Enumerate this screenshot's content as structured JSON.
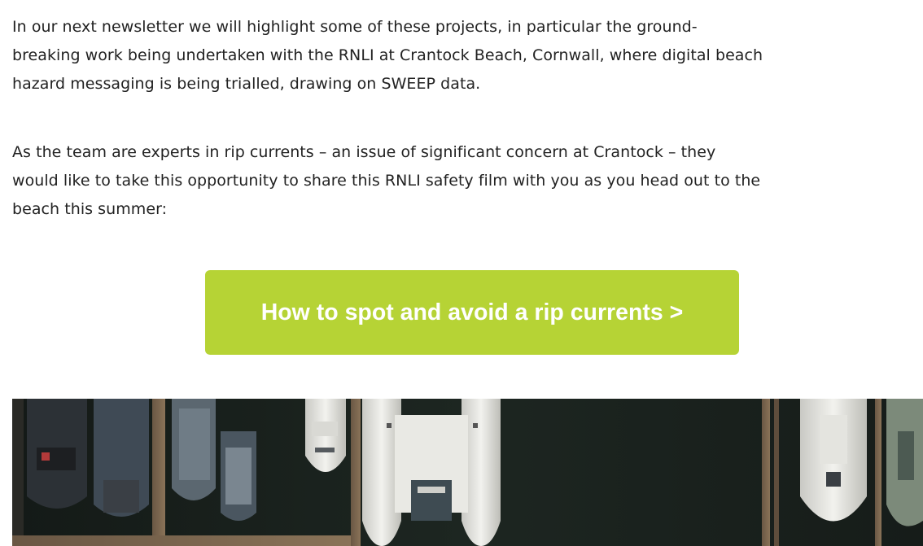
{
  "paragraphs": {
    "p1": {
      "lines": [
        "In our next newsletter we will highlight some of these projects, in particular the ground-",
        "breaking work being undertaken with the RNLI at Crantock Beach, Cornwall, where digital beach",
        "hazard messaging is being trialled, drawing on SWEEP data."
      ]
    },
    "p2": {
      "lines": [
        "As the team are experts in rip currents – an issue of significant concern at Crantock – they",
        "would like to take this opportunity to share this RNLI safety film with you as you head out to the",
        "beach this summer:"
      ]
    }
  },
  "cta": {
    "label": "How to spot and avoid a rip currents >"
  },
  "image": {
    "alt": "Boats moored in a marina, aerial view"
  },
  "colors": {
    "cta_background": "#b6d335",
    "cta_text": "#ffffff",
    "body_text": "#222222",
    "water": "#1a211d"
  }
}
